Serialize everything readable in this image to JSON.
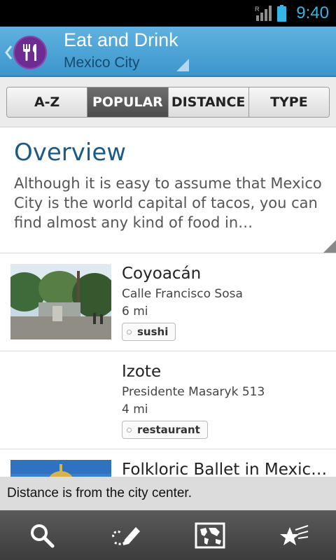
{
  "status_bar": {
    "time": "9:40",
    "signal_label": "R",
    "icons": [
      "signal-icon",
      "battery-icon"
    ]
  },
  "action_bar": {
    "title": "Eat and Drink",
    "subtitle": "Mexico City",
    "icons": [
      "back-chevron-icon",
      "fork-knife-icon",
      "spinner-corner-icon"
    ]
  },
  "tabs": [
    {
      "label": "A-Z",
      "active": false
    },
    {
      "label": "POPULAR",
      "active": true
    },
    {
      "label": "DISTANCE",
      "active": false
    },
    {
      "label": "TYPE",
      "active": false
    }
  ],
  "overview": {
    "title": "Overview",
    "text": "Although it is easy to assume that Mexico City is the world capital of tacos, you can find almost any kind of food in…"
  },
  "items": [
    {
      "name": "Coyoacán",
      "address": "Calle Francisco Sosa",
      "distance": "6 mi",
      "tag": "sushi"
    },
    {
      "name": "Izote",
      "address": "Presidente Masaryk 513",
      "distance": "4 mi",
      "tag": "restaurant"
    },
    {
      "name": "Folkloric Ballet in Mexico…",
      "address": "",
      "distance": "",
      "tag": ""
    }
  ],
  "toast": "Distance is from the city center.",
  "bottom_bar": {
    "icons": [
      "search-icon",
      "pencil-icon",
      "map-icon",
      "favorites-icon"
    ]
  },
  "colors": {
    "accent": "#35b5e5",
    "action_bar": "#4aa3d8",
    "app_icon": "#6d2c92",
    "overview_title": "#1e5a86",
    "subtitle": "#184a6e"
  }
}
